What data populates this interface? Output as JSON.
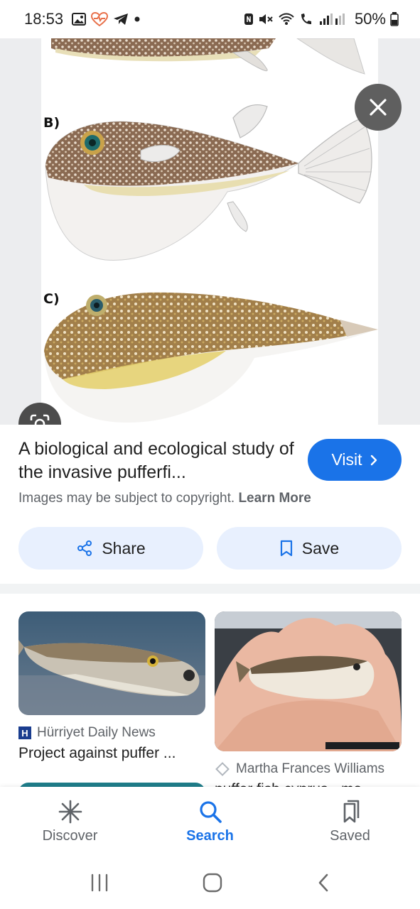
{
  "status_bar": {
    "time": "18:53",
    "battery": "50%",
    "left_icons": [
      "gallery-icon",
      "health-icon",
      "telegram-icon",
      "dot-icon"
    ],
    "right_icons": [
      "nfc-icon",
      "mute-icon",
      "wifi-icon",
      "volte-icon",
      "signal-icon",
      "battery-icon"
    ]
  },
  "viewer": {
    "figure_labels": [
      "B)",
      "C)"
    ],
    "close_icon": "close-icon",
    "lens_icon": "lens-icon"
  },
  "result": {
    "title": "A biological and ecological study of the invasive pufferfi...",
    "visit_label": "Visit",
    "copyright_text": "Images may be subject to copyright.",
    "learn_more": "Learn More",
    "share_label": "Share",
    "save_label": "Save"
  },
  "related": [
    {
      "source": "Hürriyet Daily News",
      "title": "Project against puffer ..."
    },
    {
      "source": "Martha Frances Williams",
      "title": "puffer fish cyprus - ma..."
    }
  ],
  "bottom_nav": [
    {
      "label": "Discover",
      "icon": "discover-icon",
      "active": false
    },
    {
      "label": "Search",
      "icon": "search-icon",
      "active": true
    },
    {
      "label": "Saved",
      "icon": "saved-icon",
      "active": false
    }
  ],
  "colors": {
    "accent": "#1a73e8",
    "chip_bg": "#e8f0fe"
  }
}
